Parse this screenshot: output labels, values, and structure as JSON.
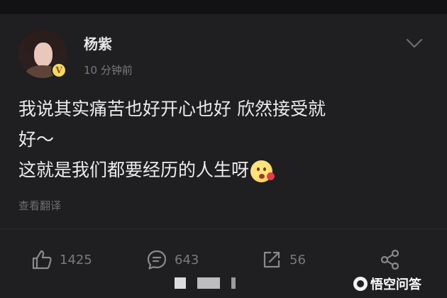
{
  "post": {
    "username": "杨紫",
    "time": "10 分钟前",
    "verified_badge": "V",
    "lines": [
      "我说其实痛苦也好开心也好 欣然接受就",
      "好～",
      "这就是我们都要经历的人生呀"
    ],
    "emoji": "kiss-emoji",
    "translate_label": "查看翻译"
  },
  "actions": {
    "like_count": "1425",
    "comment_count": "643",
    "repost_count": "56"
  },
  "watermark": {
    "text": "悟空问答"
  },
  "colors": {
    "background": "#1f1e20",
    "text": "#ececec",
    "muted": "#7a7a7a",
    "badge": "#f6d66a"
  }
}
